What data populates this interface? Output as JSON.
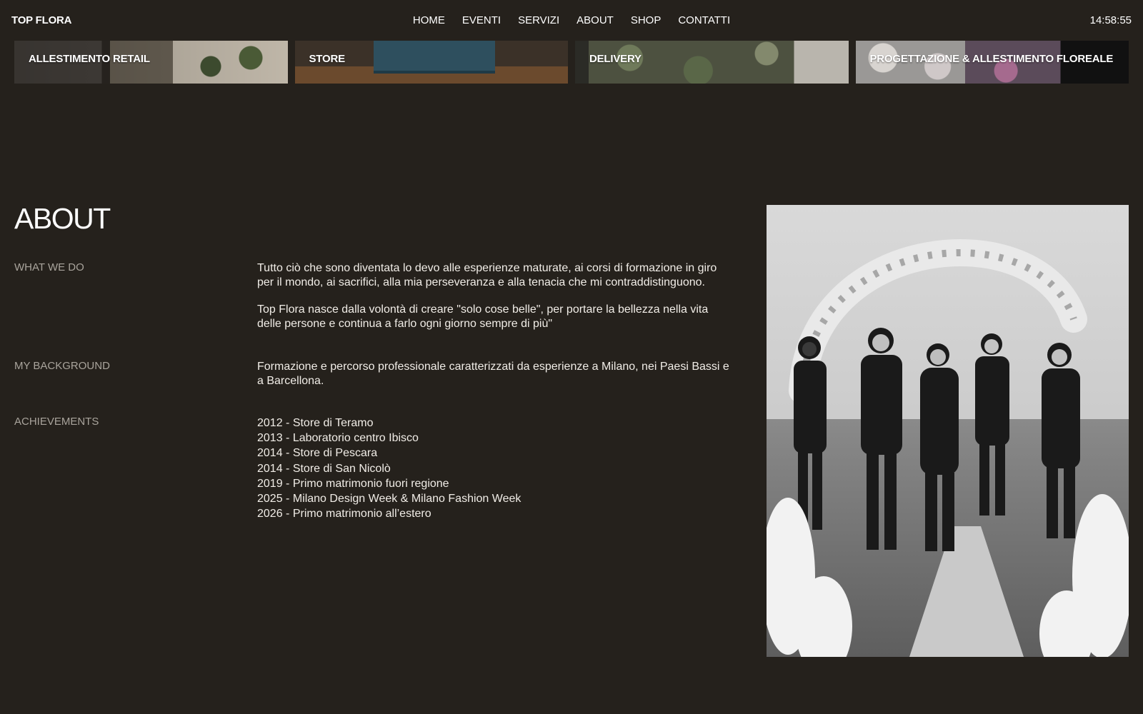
{
  "header": {
    "brand": "TOP FLORA",
    "nav": [
      "HOME",
      "EVENTI",
      "SERVIZI",
      "ABOUT",
      "SHOP",
      "CONTATTI"
    ],
    "time": "14:58:55"
  },
  "services": [
    {
      "label": "ALLESTIMENTO RETAIL"
    },
    {
      "label": "STORE"
    },
    {
      "label": "DELIVERY"
    },
    {
      "label": "PROGETTAZIONE & ALLESTIMENTO FLOREALE"
    }
  ],
  "about": {
    "title": "ABOUT",
    "what_we_do": {
      "label": "WHAT WE DO",
      "p1": "Tutto ciò che sono diventata lo devo alle esperienze maturate, ai corsi di formazione in giro per il mondo, ai sacrifici, alla mia perseveranza e alla tenacia che mi contraddistinguono.",
      "p2": "Top Flora nasce dalla volontà di creare \"solo cose belle\", per portare la bellezza nella vita delle persone e continua a farlo ogni giorno sempre di più\""
    },
    "background": {
      "label": "MY BACKGROUND",
      "text": "Formazione e percorso professionale caratterizzati da esperienze a Milano, nei Paesi Bassi e a Barcellona."
    },
    "achievements": {
      "label": "ACHIEVEMENTS",
      "items": [
        "2012 - Store di Teramo",
        "2013 - Laboratorio centro Ibisco",
        "2014 - Store di Pescara",
        "2014 - Store di San Nicolò",
        "2019 - Primo matrimonio fuori regione",
        "2025 - Milano Design Week & Milano Fashion Week",
        "2026 - Primo matrimonio all’estero"
      ]
    }
  },
  "colors": {
    "background": "#25211c",
    "text": "#ffffff",
    "muted": "#a9a49c"
  }
}
